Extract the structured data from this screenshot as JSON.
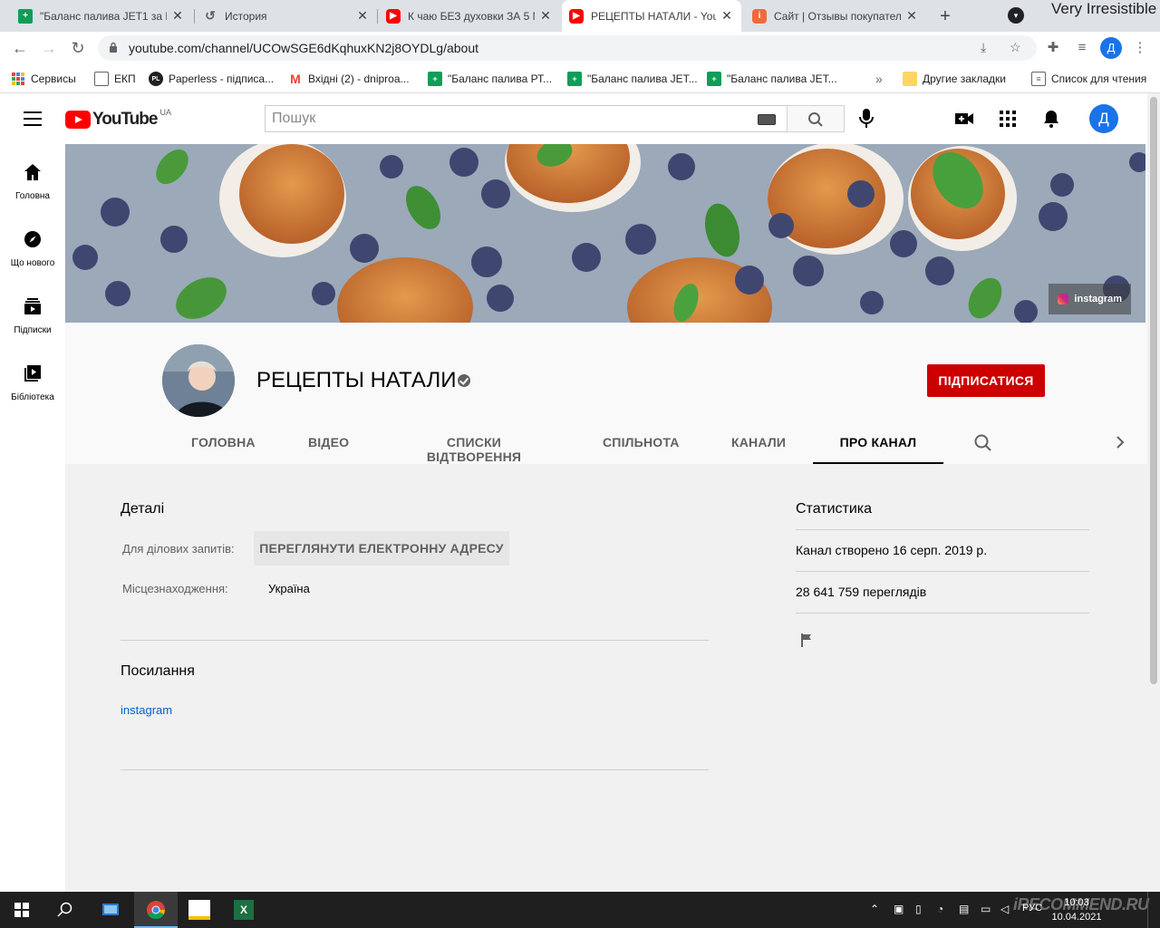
{
  "browser": {
    "window_title": "Very Irresistible",
    "tabs": [
      {
        "title": "\"Баланс палива JET1 за К",
        "favicon": "sheets-icon"
      },
      {
        "title": "История",
        "favicon": "history-icon"
      },
      {
        "title": "К чаю БЕЗ духовки ЗА 5 М",
        "favicon": "youtube-icon"
      },
      {
        "title": "РЕЦЕПТЫ НАТАЛИ - YouT",
        "favicon": "youtube-icon"
      },
      {
        "title": "Сайт | Отзывы покупател",
        "favicon": "irecommend-icon"
      }
    ],
    "url": "youtube.com/channel/UCOwSGE6dKqhuxKN2j8OYDLg/about",
    "profile_initial": "Д",
    "bookmarks": [
      {
        "label": "Сервисы",
        "icon": "apps-icon"
      },
      {
        "label": "ЕКП",
        "icon": "page-icon"
      },
      {
        "label": "Paperless - підписа...",
        "icon": "paperless-icon"
      },
      {
        "label": "Вхідні (2) - dniproa...",
        "icon": "gmail-icon"
      },
      {
        "label": "\"Баланс палива РТ...",
        "icon": "sheets-icon"
      },
      {
        "label": "\"Баланс палива JET...",
        "icon": "sheets-icon"
      },
      {
        "label": "\"Баланс палива JET...",
        "icon": "sheets-icon"
      },
      {
        "label": "Другие закладки",
        "icon": "folder-icon"
      },
      {
        "label": "Список для чтения",
        "icon": "reading-list-icon"
      }
    ],
    "overflow": "»"
  },
  "youtube": {
    "logo_text": "YouTube",
    "country_code": "UA",
    "search_placeholder": "Пошук",
    "avatar_initial": "Д",
    "guide": [
      {
        "label": "Головна",
        "icon": "home-icon"
      },
      {
        "label": "Що нового",
        "icon": "explore-icon"
      },
      {
        "label": "Підписки",
        "icon": "subscriptions-icon"
      },
      {
        "label": "Бібліотека",
        "icon": "library-icon"
      }
    ]
  },
  "channel": {
    "name": "РЕЦЕПТЫ НАТАЛИ",
    "subscribe_label": "ПІДПИСАТИСЯ",
    "banner_link": "instagram",
    "tabs": [
      {
        "label": "ГОЛОВНА",
        "active": false
      },
      {
        "label": "ВІДЕО",
        "active": false
      },
      {
        "label": "СПИСКИ ВІДТВОРЕННЯ",
        "active": false
      },
      {
        "label": "СПІЛЬНОТА",
        "active": false
      },
      {
        "label": "КАНАЛИ",
        "active": false
      },
      {
        "label": "ПРО КАНАЛ",
        "active": true
      }
    ]
  },
  "about": {
    "details_title": "Деталі",
    "business_label": "Для ділових запитів:",
    "email_button": "ПЕРЕГЛЯНУТИ ЕЛЕКТРОННУ АДРЕСУ",
    "location_label": "Місцезнаходження:",
    "location_value": "Україна",
    "links_title": "Посилання",
    "links": [
      "instagram"
    ],
    "stats_title": "Статистика",
    "created": "Канал створено 16 серп. 2019 р.",
    "views": "28 641 759 переглядів"
  },
  "taskbar": {
    "lang": "РУС",
    "time": "10:03",
    "date": "10.04.2021",
    "watermark": "iRECOMMEND.RU"
  },
  "colors": {
    "subscribe": "#cc0000",
    "link": "#065fd4",
    "youtube_red": "#ff0000",
    "avatar_blue": "#1a73e8"
  }
}
